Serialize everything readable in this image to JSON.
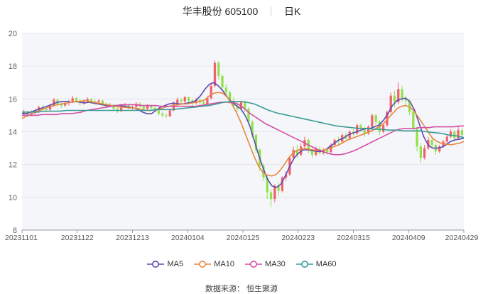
{
  "header": {
    "stock_name": "华丰股份",
    "stock_code": "605100",
    "period": "日K"
  },
  "source": "数据来源：  恒生聚源",
  "colors": {
    "up": "#f0616b",
    "down": "#8fe24a",
    "grid": "#e4e4ec",
    "plot_bg": "#f5f6fa"
  },
  "chart_data": {
    "type": "candlestick",
    "y_range": [
      8,
      20
    ],
    "y_ticks": [
      8,
      10,
      12,
      14,
      16,
      18,
      20
    ],
    "x_tick_labels": [
      "20231101",
      "20231122",
      "20231213",
      "20240104",
      "20240125",
      "20240223",
      "20240315",
      "20240409",
      "20240429"
    ],
    "trading_days": 118,
    "candles": [
      [
        15.1,
        15.2,
        15.35,
        14.95
      ],
      [
        15.2,
        15.05,
        15.3,
        14.9
      ],
      [
        15.05,
        15.15,
        15.3,
        14.95
      ],
      [
        15.15,
        15.25,
        15.4,
        15.0
      ],
      [
        15.25,
        15.5,
        15.6,
        15.15
      ],
      [
        15.5,
        15.4,
        15.65,
        15.3
      ],
      [
        15.4,
        15.35,
        15.5,
        15.2
      ],
      [
        15.35,
        15.6,
        15.7,
        15.25
      ],
      [
        15.6,
        15.95,
        16.05,
        15.5
      ],
      [
        15.95,
        15.7,
        16.0,
        15.55
      ],
      [
        15.7,
        15.6,
        15.8,
        15.45
      ],
      [
        15.6,
        15.75,
        15.85,
        15.5
      ],
      [
        15.75,
        15.85,
        15.95,
        15.6
      ],
      [
        15.85,
        16.05,
        16.2,
        15.75
      ],
      [
        16.05,
        15.9,
        16.1,
        15.75
      ],
      [
        15.9,
        15.75,
        16.0,
        15.6
      ],
      [
        15.75,
        15.85,
        15.95,
        15.65
      ],
      [
        15.85,
        16.0,
        16.1,
        15.75
      ],
      [
        16.0,
        15.85,
        16.05,
        15.7
      ],
      [
        15.85,
        15.8,
        15.95,
        15.65
      ],
      [
        15.8,
        15.9,
        16.0,
        15.7
      ],
      [
        15.9,
        15.7,
        15.95,
        15.55
      ],
      [
        15.7,
        15.6,
        15.8,
        15.45
      ],
      [
        15.6,
        15.65,
        15.75,
        15.5
      ],
      [
        15.65,
        15.4,
        15.7,
        15.3
      ],
      [
        15.4,
        15.25,
        15.5,
        15.15
      ],
      [
        15.25,
        15.55,
        15.65,
        15.2
      ],
      [
        15.55,
        15.6,
        15.75,
        15.45
      ],
      [
        15.6,
        15.45,
        15.7,
        15.35
      ],
      [
        15.45,
        15.5,
        15.6,
        15.35
      ],
      [
        15.5,
        15.7,
        15.8,
        15.4
      ],
      [
        15.7,
        15.55,
        15.8,
        15.45
      ],
      [
        15.55,
        15.4,
        15.6,
        15.3
      ],
      [
        15.4,
        15.6,
        15.7,
        15.3
      ],
      [
        15.6,
        15.45,
        15.65,
        15.35
      ],
      [
        15.45,
        15.3,
        15.55,
        15.2
      ],
      [
        15.3,
        15.1,
        15.4,
        15.0
      ],
      [
        15.1,
        15.0,
        15.2,
        14.9
      ],
      [
        15.0,
        14.95,
        15.1,
        14.85
      ],
      [
        14.95,
        15.3,
        15.4,
        14.9
      ],
      [
        15.3,
        15.7,
        15.85,
        15.25
      ],
      [
        15.7,
        15.95,
        16.1,
        15.6
      ],
      [
        15.95,
        15.85,
        16.05,
        15.7
      ],
      [
        15.85,
        16.1,
        16.2,
        15.75
      ],
      [
        16.1,
        15.9,
        16.15,
        15.75
      ],
      [
        15.9,
        15.75,
        16.0,
        15.6
      ],
      [
        15.75,
        15.95,
        16.05,
        15.65
      ],
      [
        15.95,
        15.8,
        16.0,
        15.65
      ],
      [
        15.8,
        15.7,
        15.9,
        15.55
      ],
      [
        15.7,
        16.05,
        16.15,
        15.6
      ],
      [
        16.05,
        16.8,
        17.0,
        15.95
      ],
      [
        16.8,
        18.2,
        18.35,
        16.7
      ],
      [
        18.2,
        17.4,
        18.3,
        17.2
      ],
      [
        17.4,
        16.7,
        17.5,
        16.5
      ],
      [
        16.7,
        16.4,
        16.9,
        16.2
      ],
      [
        16.4,
        15.9,
        16.5,
        15.7
      ],
      [
        15.9,
        15.6,
        16.1,
        15.4
      ],
      [
        15.6,
        15.4,
        15.8,
        15.2
      ],
      [
        15.4,
        15.8,
        15.9,
        15.3
      ],
      [
        15.8,
        15.4,
        15.9,
        15.2
      ],
      [
        15.4,
        14.6,
        15.5,
        14.4
      ],
      [
        14.6,
        13.8,
        14.7,
        13.6
      ],
      [
        13.8,
        12.9,
        13.9,
        12.7
      ],
      [
        12.9,
        11.9,
        13.0,
        11.6
      ],
      [
        11.9,
        11.2,
        12.1,
        11.0
      ],
      [
        11.2,
        10.3,
        11.3,
        9.9
      ],
      [
        10.3,
        9.9,
        10.5,
        9.4
      ],
      [
        9.9,
        10.7,
        10.8,
        9.7
      ],
      [
        10.7,
        10.4,
        10.9,
        10.1
      ],
      [
        10.4,
        11.2,
        11.3,
        10.3
      ],
      [
        11.2,
        11.4,
        11.6,
        11.0
      ],
      [
        11.4,
        12.4,
        12.5,
        11.3
      ],
      [
        12.4,
        12.9,
        13.1,
        12.3
      ],
      [
        12.9,
        12.6,
        13.2,
        12.4
      ],
      [
        12.6,
        13.1,
        13.3,
        12.5
      ],
      [
        13.1,
        13.5,
        13.7,
        13.0
      ],
      [
        13.5,
        12.9,
        13.6,
        12.7
      ],
      [
        12.9,
        12.6,
        13.0,
        12.4
      ],
      [
        12.6,
        12.95,
        13.1,
        12.5
      ],
      [
        12.95,
        12.7,
        13.1,
        12.6
      ],
      [
        12.7,
        12.9,
        13.0,
        12.6
      ],
      [
        12.9,
        12.75,
        13.0,
        12.6
      ],
      [
        12.75,
        13.2,
        13.3,
        12.7
      ],
      [
        13.2,
        13.5,
        13.6,
        13.1
      ],
      [
        13.5,
        13.4,
        13.7,
        13.2
      ],
      [
        13.4,
        13.8,
        13.9,
        13.3
      ],
      [
        13.8,
        13.6,
        13.95,
        13.5
      ],
      [
        13.6,
        14.0,
        14.1,
        13.5
      ],
      [
        14.0,
        13.9,
        14.15,
        13.75
      ],
      [
        13.9,
        14.4,
        14.5,
        13.8
      ],
      [
        14.4,
        14.2,
        14.5,
        14.05
      ],
      [
        14.2,
        13.9,
        14.3,
        13.7
      ],
      [
        13.9,
        14.3,
        14.4,
        13.8
      ],
      [
        14.3,
        15.0,
        15.1,
        14.2
      ],
      [
        15.0,
        14.6,
        15.1,
        14.4
      ],
      [
        14.6,
        14.0,
        14.7,
        13.8
      ],
      [
        14.0,
        14.4,
        14.5,
        13.9
      ],
      [
        14.4,
        15.2,
        15.3,
        14.3
      ],
      [
        15.2,
        16.2,
        16.4,
        15.1
      ],
      [
        16.2,
        15.8,
        16.5,
        15.5
      ],
      [
        15.8,
        16.6,
        17.0,
        15.7
      ],
      [
        16.6,
        16.0,
        16.8,
        15.8
      ],
      [
        16.0,
        15.9,
        16.2,
        15.6
      ],
      [
        15.9,
        15.2,
        16.0,
        15.0
      ],
      [
        15.2,
        14.2,
        15.3,
        14.0
      ],
      [
        14.2,
        13.1,
        14.3,
        12.8
      ],
      [
        13.1,
        12.4,
        13.3,
        12.1
      ],
      [
        12.4,
        13.0,
        13.2,
        12.3
      ],
      [
        13.0,
        13.5,
        13.7,
        12.9
      ],
      [
        13.5,
        13.2,
        13.7,
        13.0
      ],
      [
        13.2,
        12.8,
        13.3,
        12.6
      ],
      [
        12.8,
        13.1,
        13.2,
        12.7
      ],
      [
        13.1,
        13.4,
        13.5,
        13.0
      ],
      [
        13.4,
        13.7,
        13.8,
        13.3
      ],
      [
        13.7,
        14.0,
        14.15,
        13.6
      ],
      [
        14.0,
        13.6,
        14.1,
        13.4
      ],
      [
        13.6,
        14.1,
        14.3,
        13.5
      ],
      [
        14.1,
        13.8,
        14.2,
        13.6
      ]
    ],
    "series": [
      {
        "name": "MA5",
        "color": "#5c4ab3",
        "values": [
          15.1,
          15.1,
          15.2,
          15.3,
          15.4,
          15.5,
          15.6,
          15.7,
          15.8,
          15.85,
          15.85,
          15.8,
          15.85,
          15.8,
          15.75,
          15.8,
          15.75,
          15.7,
          15.65,
          15.6,
          15.55,
          15.6,
          15.6,
          15.55,
          15.5,
          15.45,
          15.35,
          15.2,
          15.1,
          15.1,
          15.3,
          15.5,
          15.6,
          15.7,
          15.75,
          15.7,
          15.7,
          15.75,
          15.8,
          15.9,
          16.2,
          16.6,
          16.9,
          17.0,
          16.8,
          16.5,
          16.1,
          15.8,
          15.6,
          15.4,
          15.0,
          14.4,
          13.5,
          12.6,
          11.8,
          11.1,
          10.7,
          10.6,
          10.8,
          11.3,
          11.9,
          12.4,
          12.7,
          12.9,
          12.9,
          12.85,
          12.8,
          12.8,
          12.9,
          13.1,
          13.3,
          13.5,
          13.6,
          13.8,
          13.9,
          14.0,
          14.1,
          14.2,
          14.2,
          14.3,
          14.4,
          14.7,
          15.1,
          15.6,
          15.9,
          16.0,
          16.05,
          15.8,
          15.3,
          14.5,
          13.7,
          13.2,
          13.0,
          13.0,
          13.05,
          13.2,
          13.4,
          13.5,
          13.55,
          13.6
        ]
      },
      {
        "name": "MA10",
        "color": "#e8873d",
        "values": [
          14.8,
          14.95,
          15.05,
          15.2,
          15.3,
          15.4,
          15.5,
          15.6,
          15.65,
          15.7,
          15.75,
          15.8,
          15.85,
          15.85,
          15.9,
          15.85,
          15.8,
          15.75,
          15.7,
          15.65,
          15.6,
          15.55,
          15.5,
          15.5,
          15.45,
          15.45,
          15.4,
          15.35,
          15.3,
          15.3,
          15.35,
          15.4,
          15.5,
          15.55,
          15.6,
          15.65,
          15.7,
          15.7,
          15.75,
          15.8,
          15.85,
          15.95,
          16.2,
          16.35,
          16.4,
          16.35,
          16.1,
          15.7,
          15.2,
          14.6,
          13.9,
          13.2,
          12.5,
          11.9,
          11.5,
          11.35,
          11.3,
          11.4,
          11.7,
          12.1,
          12.5,
          12.75,
          12.9,
          12.95,
          12.95,
          12.9,
          12.85,
          12.85,
          12.9,
          13.0,
          13.1,
          13.2,
          13.35,
          13.5,
          13.6,
          13.7,
          13.8,
          13.9,
          14.0,
          14.15,
          14.3,
          14.5,
          14.8,
          15.1,
          15.4,
          15.55,
          15.6,
          15.5,
          15.2,
          14.8,
          14.4,
          14.0,
          13.6,
          13.4,
          13.3,
          13.25,
          13.2,
          13.25,
          13.3,
          13.4
        ]
      },
      {
        "name": "MA30",
        "color": "#d34fa6",
        "values": [
          15.0,
          15.0,
          15.0,
          15.0,
          15.05,
          15.05,
          15.05,
          15.05,
          15.1,
          15.1,
          15.1,
          15.15,
          15.2,
          15.3,
          15.35,
          15.4,
          15.45,
          15.5,
          15.55,
          15.6,
          15.65,
          15.65,
          15.65,
          15.65,
          15.6,
          15.6,
          15.6,
          15.6,
          15.55,
          15.55,
          15.55,
          15.55,
          15.55,
          15.55,
          15.55,
          15.55,
          15.6,
          15.65,
          15.7,
          15.75,
          15.8,
          15.8,
          15.8,
          15.75,
          15.6,
          15.35,
          15.1,
          14.9,
          14.7,
          14.5,
          14.35,
          14.2,
          14.05,
          13.9,
          13.75,
          13.6,
          13.45,
          13.3,
          13.15,
          13.0,
          12.85,
          12.75,
          12.65,
          12.6,
          12.6,
          12.65,
          12.75,
          12.85,
          13.0,
          13.15,
          13.3,
          13.45,
          13.6,
          13.75,
          13.9,
          14.05,
          14.15,
          14.2,
          14.2,
          14.2,
          14.25,
          14.25,
          14.25,
          14.3,
          14.3,
          14.3,
          14.3,
          14.3,
          14.35,
          14.35
        ]
      },
      {
        "name": "MA60",
        "color": "#3a9b95",
        "values": [
          15.2,
          15.2,
          15.2,
          15.25,
          15.25,
          15.25,
          15.3,
          15.3,
          15.3,
          15.3,
          15.3,
          15.3,
          15.3,
          15.3,
          15.3,
          15.3,
          15.3,
          15.3,
          15.35,
          15.35,
          15.35,
          15.4,
          15.45,
          15.5,
          15.55,
          15.6,
          15.7,
          15.8,
          15.85,
          15.85,
          15.8,
          15.7,
          15.5,
          15.3,
          15.15,
          15.05,
          14.95,
          14.85,
          14.75,
          14.65,
          14.55,
          14.45,
          14.35,
          14.3,
          14.25,
          14.2,
          14.2,
          14.15,
          14.15,
          14.1,
          14.1,
          14.05,
          14.05,
          14.05,
          14.0,
          13.95,
          13.9,
          13.8,
          13.75,
          13.65
        ]
      }
    ],
    "legend_position": "bottom-center",
    "grid": true
  }
}
